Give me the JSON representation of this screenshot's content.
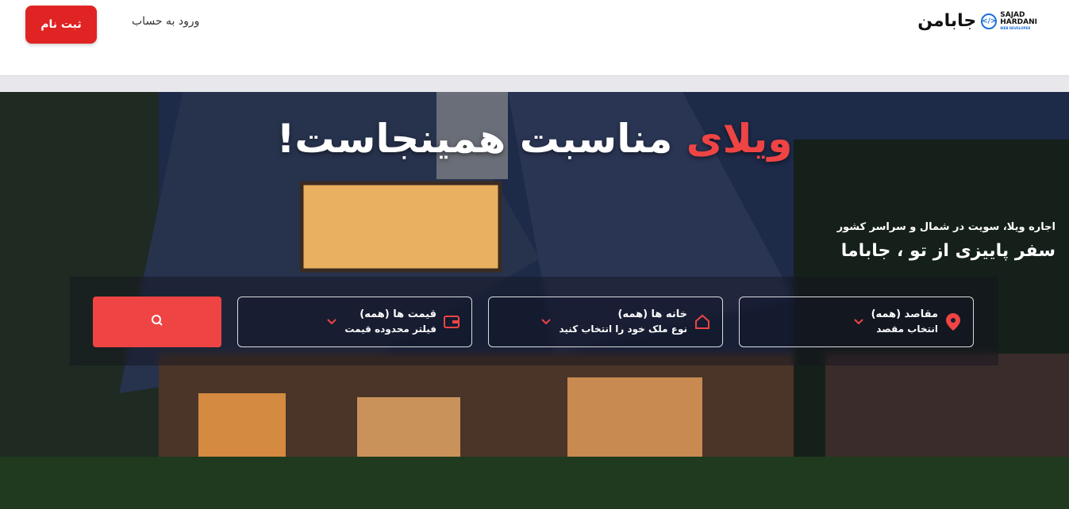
{
  "header": {
    "signup_label": "ثبت نام",
    "login_label": "ورود به حساب",
    "brand_name": "جابامن",
    "logo_line1": "SAJAD",
    "logo_line2": "HARDANI",
    "logo_line3": "WEB DEVELOPER",
    "logo_glyph": "</>"
  },
  "hero": {
    "title_accent": "ویلای",
    "title_rest": " مناسبت همینجاست!",
    "subtitle_small": "اجاره ویلا، سویت در شمال و سراسر کشور",
    "subtitle_large": "سفر پاییزی از تو ، جاباما"
  },
  "search": {
    "destination": {
      "title": "مقاصد (همه)",
      "hint": "انتخاب مقصد",
      "icon": "location-pin-icon"
    },
    "home_type": {
      "title": "خانه ها (همه)",
      "hint": "نوع ملک خود را انتخاب کنید",
      "icon": "home-icon"
    },
    "price": {
      "title": "قیمت ها (همه)",
      "hint": "فیلتر محدوده قیمت",
      "icon": "wallet-icon"
    },
    "search_icon": "search-icon"
  },
  "colors": {
    "accent": "#ef4444",
    "signup": "#e02424",
    "logo_blue": "#1e6fd9"
  }
}
